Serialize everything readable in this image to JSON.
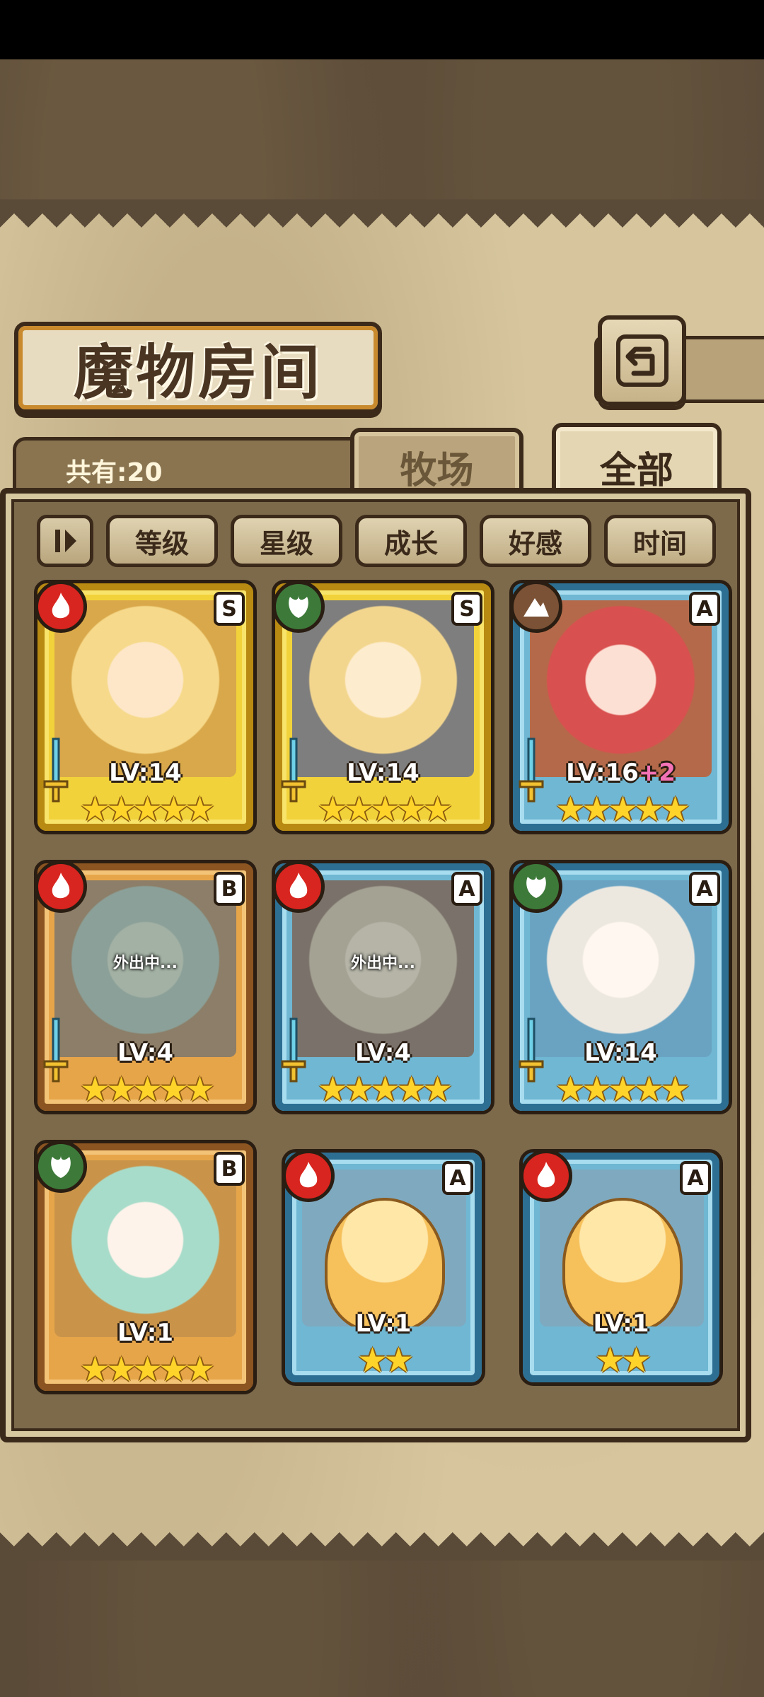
{
  "header": {
    "title": "魔物房间",
    "back_icon": "back-return-icon"
  },
  "summary": {
    "total_label": "共有:20"
  },
  "tabs": [
    {
      "label": "牧场",
      "active": false
    },
    {
      "label": "全部",
      "active": true
    }
  ],
  "sort": {
    "toggle_icon": "sort-order-icon",
    "options": [
      "等级",
      "星级",
      "成长",
      "好感",
      "时间"
    ]
  },
  "monsters": [
    {
      "element": "fire",
      "rank": "S",
      "level": "LV:14",
      "bonus": "",
      "stars": "★★★★★",
      "frame": "gold",
      "status": ""
    },
    {
      "element": "leaf",
      "rank": "S",
      "level": "LV:14",
      "bonus": "",
      "stars": "★★★★★",
      "frame": "gold",
      "status": ""
    },
    {
      "element": "earth",
      "rank": "A",
      "level": "LV:16",
      "bonus": "+2",
      "stars": "★★★★★",
      "frame": "blue",
      "status": ""
    },
    {
      "element": "fire",
      "rank": "B",
      "level": "LV:4",
      "bonus": "",
      "stars": "★★★★★",
      "frame": "bronze",
      "status": "外出中..."
    },
    {
      "element": "fire",
      "rank": "A",
      "level": "LV:4",
      "bonus": "",
      "stars": "★★★★★",
      "frame": "blue",
      "status": "外出中..."
    },
    {
      "element": "leaf",
      "rank": "A",
      "level": "LV:14",
      "bonus": "",
      "stars": "★★★★★",
      "frame": "blue",
      "status": ""
    },
    {
      "element": "leaf",
      "rank": "B",
      "level": "LV:1",
      "bonus": "",
      "stars": "★★★★★",
      "frame": "bronze",
      "status": ""
    },
    {
      "element": "fire",
      "rank": "A",
      "level": "LV:1",
      "bonus": "",
      "stars": "★★",
      "frame": "card",
      "status": ""
    },
    {
      "element": "fire",
      "rank": "A",
      "level": "LV:1",
      "bonus": "",
      "stars": "★★",
      "frame": "card",
      "status": ""
    }
  ],
  "colors": {
    "fire": "#d8251f",
    "leaf": "#3d7a3a",
    "earth": "#7b5236",
    "star": "#ffd42a",
    "level_bonus": "#f472b6"
  }
}
